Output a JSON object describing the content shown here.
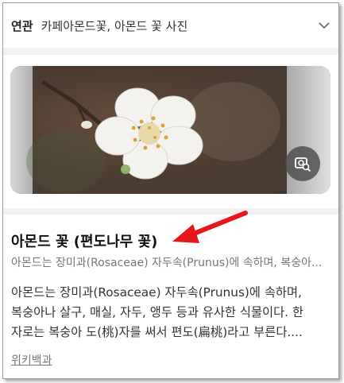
{
  "related": {
    "label": "연관",
    "text": "카페아몬드꽃, 아몬드 꽃 사진"
  },
  "result": {
    "title": "아몬드 꽃 (편도나무 꽃)",
    "subtitle": "아몬드는 장미과(Rosaceae) 자두속(Prunus)에 속하며, 복숭아...",
    "description_lines": [
      "아몬드는 장미과(Rosaceae) 자두속(Prunus)에 속하며,",
      "복숭아나 살구, 매실, 자두, 앵두 등과 유사한 식물이다. 한",
      "자로는 복숭아 도(桃)자를 써서 편도(扁桃)라고 부른다...."
    ],
    "source": "위키백과"
  },
  "icons": {
    "chevron": "chevron-down-icon",
    "lens": "image-search-icon",
    "arrow": "red-arrow-annotation"
  },
  "colors": {
    "arrow": "#e8161b",
    "divider": "#f2f2f4"
  }
}
